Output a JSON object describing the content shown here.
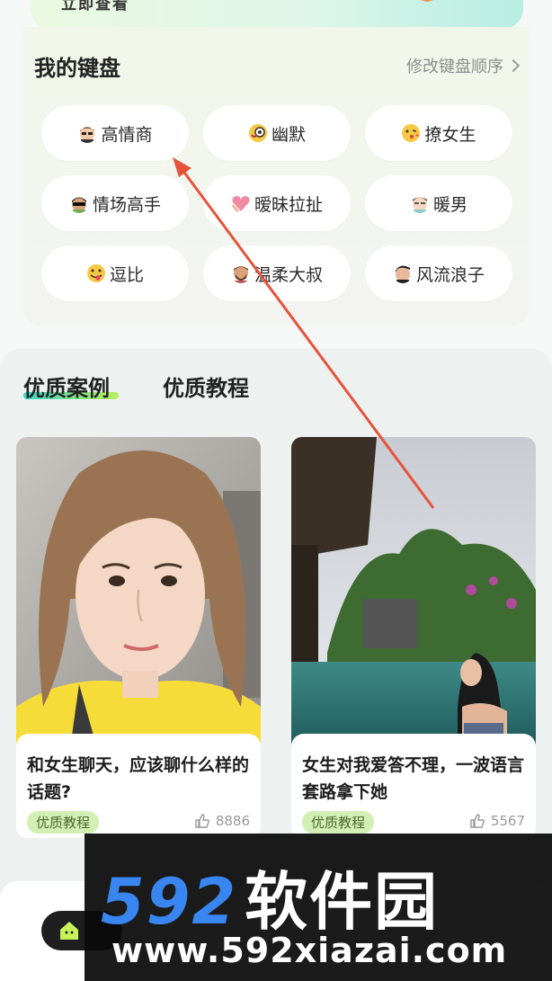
{
  "banner": {
    "partial_text": "立即查看"
  },
  "keyboard": {
    "title": "我的键盘",
    "reorder_link": "修改键盘顺序",
    "buttons": [
      {
        "label": "高情商",
        "icon": "man-glasses-icon"
      },
      {
        "label": "幽默",
        "icon": "laughing-face-icon"
      },
      {
        "label": "撩女生",
        "icon": "kissing-face-icon"
      },
      {
        "label": "情场高手",
        "icon": "sunglasses-man-icon"
      },
      {
        "label": "暧昧拉扯",
        "icon": "heart-hands-icon"
      },
      {
        "label": "暖男",
        "icon": "gentle-man-icon"
      },
      {
        "label": "逗比",
        "icon": "silly-face-icon"
      },
      {
        "label": "温柔大叔",
        "icon": "bearded-man-icon"
      },
      {
        "label": "风流浪子",
        "icon": "stylish-man-icon"
      }
    ]
  },
  "tabs": [
    {
      "label": "优质案例",
      "active": true
    },
    {
      "label": "优质教程",
      "active": false
    }
  ],
  "cards": [
    {
      "title": "和女生聊天，应该聊什么样的话题?",
      "badge": "优质教程",
      "likes": "8886"
    },
    {
      "title": "女生对我爱答不理，一波语言套路拿下她",
      "badge": "优质教程",
      "likes": "5567"
    }
  ],
  "watermark": {
    "digits": "592",
    "brand": "软件园",
    "url": "www.592xiazai.com"
  },
  "colors": {
    "accent_gradient_start": "#39d5c7",
    "accent_gradient_end": "#b9ee5a",
    "badge_bg": "#d2f0b4",
    "arrow": "#e5533c"
  }
}
